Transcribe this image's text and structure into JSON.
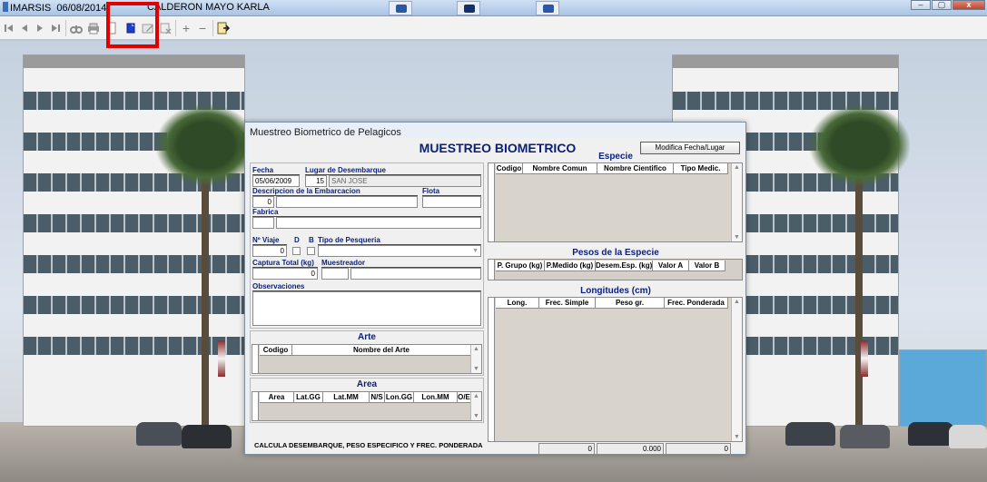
{
  "window": {
    "app_name": "IMARSIS",
    "date": "06/08/2014",
    "user": "CALDERON MAYO KARLA"
  },
  "toolbar": {
    "buttons": [
      "first-record-icon",
      "previous-record-icon",
      "next-record-icon",
      "last-record-icon",
      "binoculars-icon",
      "print-icon",
      "preview-icon",
      "new-document-icon",
      "edit-document-icon",
      "delete-document-icon",
      "add-icon",
      "remove-icon",
      "exit-icon"
    ],
    "add_label": "+",
    "remove_label": "−",
    "highlight_color": "#e00000"
  },
  "dialog": {
    "title": "Muestreo Biometrico de Pelagicos",
    "heading": "MUESTREO BIOMETRICO",
    "modify_button": "Modifica Fecha/Lugar",
    "fecha_label": "Fecha",
    "fecha_value": "05/06/2009",
    "lugar_label": "Lugar de Desembarque",
    "lugar_code": "15",
    "lugar_name": "SAN JOSE",
    "embarcacion_label": "Descripcion de la Embarcacion",
    "embarcacion_code": "0",
    "flota_label": "Flota",
    "fabrica_label": "Fabrica",
    "viaje_label": "Nº Viaje",
    "viaje_value": "0",
    "d_label": "D",
    "b_label": "B",
    "pesqueria_label": "Tipo de Pesqueria",
    "captura_label": "Captura Total (kg)",
    "captura_value": "0",
    "muestreador_label": "Muestreador",
    "observaciones_label": "Observaciones",
    "footer_text": "CALCULA DESEMBARQUE, PESO ESPECIFICO Y FREC. PONDERADA"
  },
  "arte": {
    "title": "Arte",
    "columns": [
      "Codigo",
      "Nombre del Arte"
    ]
  },
  "area": {
    "title": "Area",
    "columns": [
      "Area",
      "Lat.GG",
      "Lat.MM",
      "N/S",
      "Lon.GG",
      "Lon.MM",
      "O/E"
    ]
  },
  "especie": {
    "title": "Especie",
    "columns": [
      "Codigo",
      "Nombre Comun",
      "Nombre Cientifico",
      "Tipo Medic."
    ]
  },
  "pesos": {
    "title": "Pesos de la Especie",
    "columns": [
      "P. Grupo (kg)",
      "P.Medido (kg)",
      "Desem.Esp. (kg)",
      "Valor A",
      "Valor B"
    ]
  },
  "longitudes": {
    "title": "Longitudes (cm)",
    "columns": [
      "Long.",
      "Frec. Simple",
      "Peso gr.",
      "Frec. Ponderada"
    ],
    "totals": [
      "0",
      "0.000",
      "0"
    ]
  },
  "colors": {
    "label_blue": "#0a1f7a",
    "title_blue": "#0a1f7a"
  }
}
